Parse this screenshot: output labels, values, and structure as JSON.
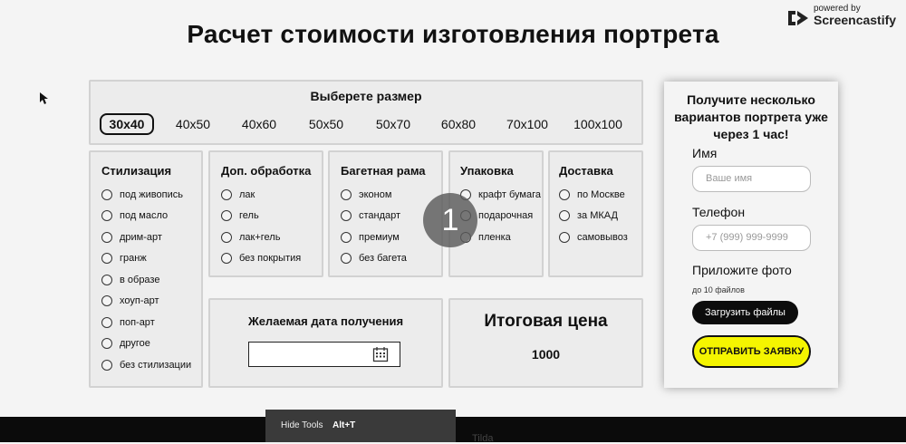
{
  "page": {
    "title": "Расчет стоимости изготовления портрета"
  },
  "branding": {
    "powered_by": "powered by",
    "name": "Screencastify"
  },
  "sizes": {
    "title": "Выберете размер",
    "options": [
      "30x40",
      "40x50",
      "40x60",
      "50x50",
      "50x70",
      "60x80",
      "70x100",
      "100x100"
    ],
    "selected": "30x40"
  },
  "stylization": {
    "title": "Стилизация",
    "options": [
      "под живопись",
      "под масло",
      "дрим-арт",
      "гранж",
      "в образе",
      "хоуп-арт",
      "поп-арт",
      "другое",
      "без стилизации"
    ]
  },
  "processing": {
    "title": "Доп. обработка",
    "options": [
      "лак",
      "гель",
      "лак+гель",
      "без покрытия"
    ]
  },
  "frame": {
    "title": "Багетная рама",
    "options": [
      "эконом",
      "стандарт",
      "премиум",
      "без багета"
    ]
  },
  "packaging": {
    "title": "Упаковка",
    "options": [
      "крафт бумага",
      "подарочная",
      "пленка"
    ]
  },
  "delivery": {
    "title": "Доставка",
    "options": [
      "по Москве",
      "за МКАД",
      "самовывоз"
    ]
  },
  "date": {
    "title": "Желаемая дата получения",
    "value": ""
  },
  "total": {
    "title": "Итоговая цена",
    "value": "1000"
  },
  "form": {
    "title": "Получите несколько вариантов портрета уже через 1 час!",
    "name_label": "Имя",
    "name_placeholder": "Ваше имя",
    "phone_label": "Телефон",
    "phone_placeholder": "+7 (999) 999-9999",
    "photo_label": "Приложите фото",
    "photo_hint": "до 10 файлов",
    "upload_label": "Загрузить файлы",
    "submit_label": "ОТПРАВИТЬ ЗАЯВКУ",
    "colors": {
      "submit_bg": "#f5f500",
      "upload_bg": "#0c0c0c"
    }
  },
  "overlay": {
    "click_badge": "1",
    "tooltip_label": "Hide Tools",
    "tooltip_shortcut": "Alt+T",
    "footer_text": "Tilda"
  }
}
